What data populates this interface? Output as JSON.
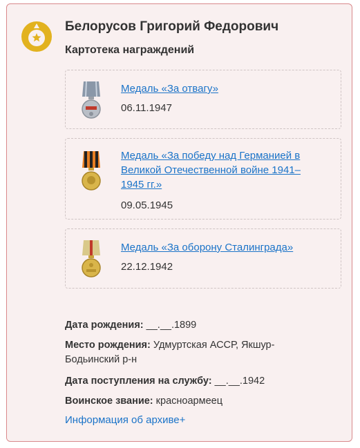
{
  "person": {
    "name": "Белорусов Григорий Федорович",
    "subtitle": "Картотека награждений"
  },
  "awards": [
    {
      "title": "Медаль «За отвагу»",
      "date": "06.11.1947"
    },
    {
      "title_lines": [
        "Медаль «За победу над Германией в",
        "Великой Отечественной войне 1941–",
        "1945 гг.»"
      ],
      "date": "09.05.1945"
    },
    {
      "title": "Медаль «За оборону Сталинграда»",
      "date": "22.12.1942"
    }
  ],
  "details": {
    "birth_date_label": "Дата рождения:",
    "birth_date_value": "__.__.1899",
    "birth_place_label": "Место рождения:",
    "birth_place_value_line1": "Удмуртская АССР, Якшур-",
    "birth_place_value_line2": "Бодьинский р-н",
    "service_date_label": "Дата поступления на службу:",
    "service_date_value": "__.__.1942",
    "rank_label": "Воинское звание:",
    "rank_value": "красноармеец"
  },
  "archive_link": "Информация об архиве+",
  "colors": {
    "accent_gold": "#e2b21f",
    "link_blue": "#1a73c8",
    "card_border": "#d9878a",
    "card_bg": "#f9f0f0"
  },
  "icons": {
    "badge": "star-medal-icon",
    "award1": "medal-for-courage-icon",
    "award2": "medal-victory-over-germany-icon",
    "award3": "medal-defense-of-stalingrad-icon"
  }
}
